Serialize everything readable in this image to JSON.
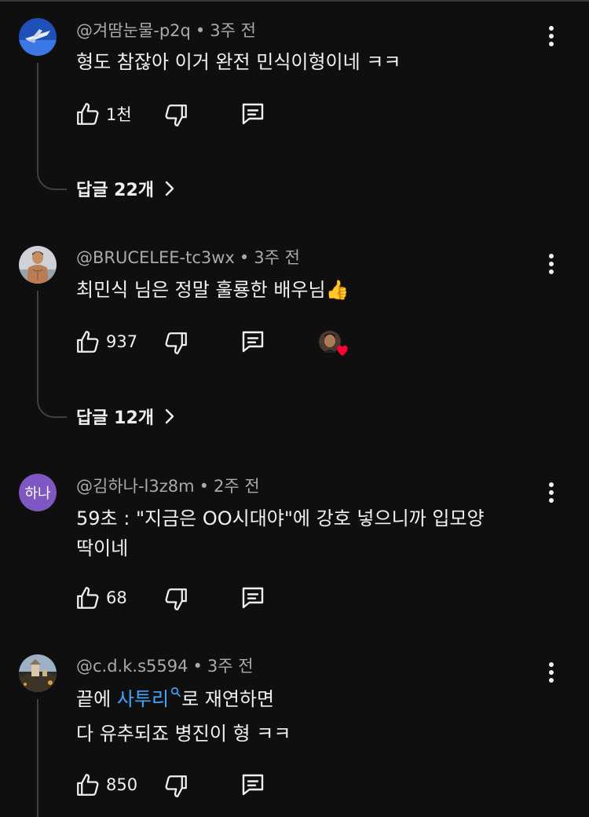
{
  "comments": [
    {
      "author": "@겨땀눈물-p2q",
      "time": "3주 전",
      "lines": [
        "형도 참잖아 이거 완전 민식이형이네 ㅋㅋ"
      ],
      "likes": "1천",
      "replies": "답글 22개"
    },
    {
      "author": "@BRUCELEE-tc3wx",
      "time": "3주 전",
      "lines": [
        "최민식 님은 정말 훌룡한 배우님"
      ],
      "emoji": "👍",
      "likes": "937",
      "replies": "답글 12개"
    },
    {
      "author": "@김하나-l3z8m",
      "time": "2주 전",
      "avatar_text": "하나",
      "avatar_color": "#7e57c2",
      "lines": [
        "59초 : \"지금은 OO시대야\"에 강호 넣으니까 입모양",
        "딱이네"
      ],
      "likes": "68"
    },
    {
      "author": "@c.d.k.s5594",
      "time": "3주 전",
      "line1_before": "끝에",
      "line1_link": "사투리",
      "line1_after": "로 재연하면",
      "line2": "다 유추되죠 병진이 형 ㅋㅋ",
      "likes": "850"
    }
  ],
  "colors": {
    "background": "#0f0f0f",
    "link": "#3ea6ff",
    "heart": "#ff0033"
  }
}
